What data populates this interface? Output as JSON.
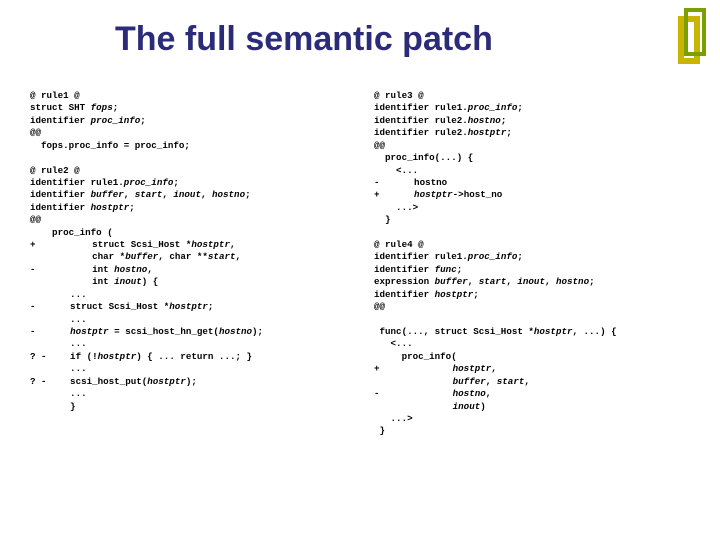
{
  "title": "The full semantic patch",
  "left": {
    "r1_header": "@ rule1 @",
    "r1_l1a": "struct SHT ",
    "r1_l1b": "fops",
    "r1_l2a": "identifier ",
    "r1_l2b": "proc_info",
    "r1_at": "@@",
    "r1_body": "  fops.proc_info = proc_info;",
    "r2_header": "@ rule2 @",
    "r2_l1a": "identifier rule1.",
    "r2_l1b": "proc_info",
    "r2_l2a": "identifier ",
    "r2_l2b": "buffer",
    "r2_l2c": "start",
    "r2_l2d": "inout",
    "r2_l2e": "hostno",
    "r2_l3a": "identifier ",
    "r2_l3b": "hostptr",
    "r2_at": "@@",
    "b_open": "    proc_info (",
    "b_plus": "+",
    "b_scsi": "        struct Scsi_Host *",
    "b_hostptr": "hostptr",
    "b_char": "        char *",
    "b_buffer": "buffer",
    "b_charss": ", char **",
    "b_start": "start",
    "b_int": "        int ",
    "b_hostno": "hostno",
    "b_inout": "inout",
    "b_brace": ") {",
    "b_minus": "-",
    "b_dots": "    ...",
    "b_structscsi": "    struct Scsi_Host *",
    "b_semi": ";",
    "b_dots2": "    ...",
    "b_assign1": "    ",
    "b_assign2": " = scsi_host_hn_get(",
    "b_assign3": ");",
    "b_qm": "? -",
    "b_ifnot": "    if (!",
    "b_ifrest": ") { ... return ...; }",
    "b_scsihostput": "    scsi_host_put(",
    "b_scsihostput2": ");",
    "b_close": "    }"
  },
  "right": {
    "r3_header": "@ rule3 @",
    "r3_l1a": "identifier rule1.",
    "r3_l1b": "proc_info",
    "r3_l2a": "identifier rule2.",
    "r3_l2b": "hostno",
    "r3_l3a": "identifier rule2.",
    "r3_l3b": "hostptr",
    "r3_at": "@@",
    "r3_b1": "  proc_info(...) {",
    "r3_b2": "    <...",
    "r3_minus": "-",
    "r3_b3": "    hostno",
    "r3_plus": "+",
    "r3_b4a": "    hostptr",
    "r3_b4b": "->",
    "r3_b4c": "host_no",
    "r3_b5": "    ...>",
    "r3_b6": "  }",
    "r4_header": "@ rule4 @",
    "r4_l1a": "identifier rule1.",
    "r4_l1b": "proc_info",
    "r4_l2a": "identifier ",
    "r4_l2b": "func",
    "r4_l3a": "expression ",
    "r4_l3b": "buffer",
    "r4_l3c": "start",
    "r4_l3d": "inout",
    "r4_l3e": "hostno",
    "r4_l4a": "identifier ",
    "r4_l4b": "hostptr",
    "r4_at": "@@",
    "r4_b1a": " func(..., struct Scsi_Host *",
    "r4_b1b": "hostptr",
    "r4_b1c": ", ...) {",
    "r4_b2": "   <...",
    "r4_b3": "     proc_info(",
    "r4_plus": "+",
    "r4_b4a": "           ",
    "r4_b4b": "hostptr",
    "r4_b4c": ",",
    "r4_b5a": "           ",
    "r4_b5b": "buffer",
    "r4_b5c": "start",
    "r4_minus": "-",
    "r4_b6a": "           ",
    "r4_b6b": "hostno",
    "r4_b7a": "           ",
    "r4_b7b": "inout",
    "r4_b7c": ")",
    "r4_b8": "   ...>",
    "r4_b9": " }"
  }
}
